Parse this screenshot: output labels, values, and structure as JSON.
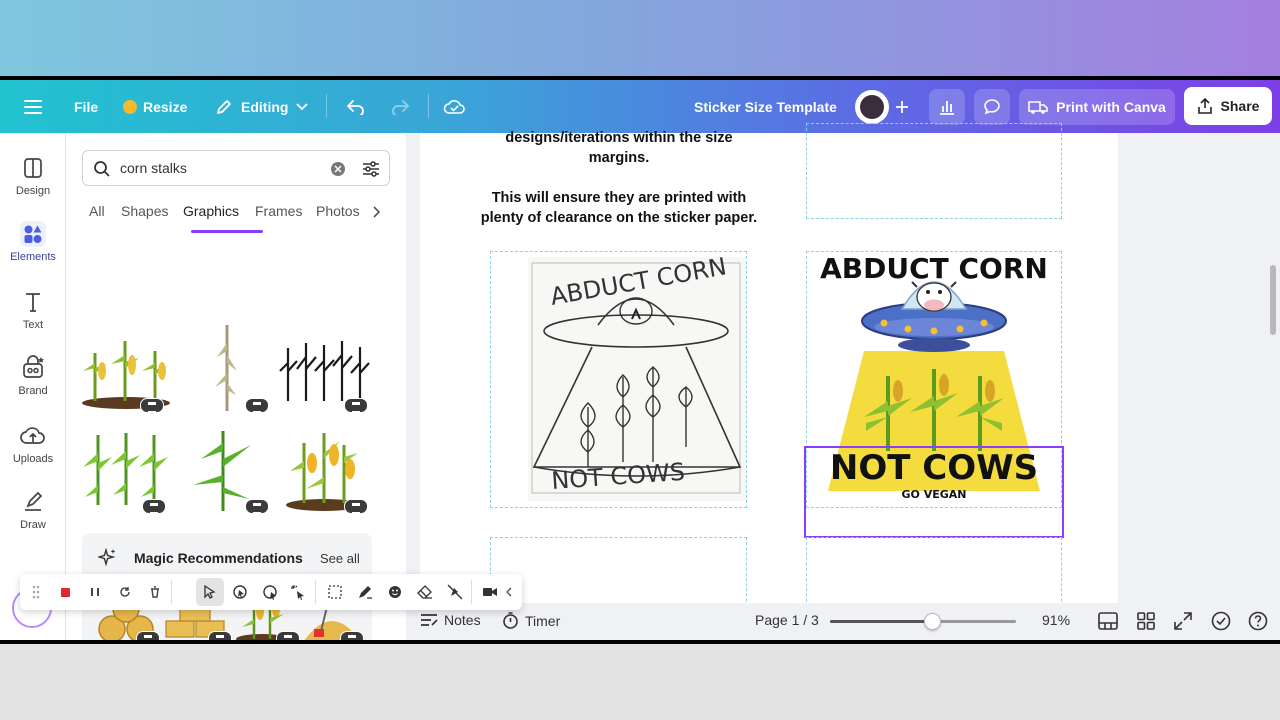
{
  "header": {
    "menu_icon": "hamburger-icon",
    "file_label": "File",
    "resize_label": "Resize",
    "editing_label": "Editing",
    "title": "Sticker Size Template",
    "print_label": "Print with Canva",
    "share_label": "Share",
    "colors": {
      "gradient_start": "#21c2cf",
      "gradient_end": "#7d3fe6",
      "accent": "#8b3dff"
    }
  },
  "rail": {
    "items": [
      {
        "label": "Design",
        "icon": "design-icon"
      },
      {
        "label": "Elements",
        "icon": "elements-icon"
      },
      {
        "label": "Text",
        "icon": "text-icon"
      },
      {
        "label": "Brand",
        "icon": "brand-icon"
      },
      {
        "label": "Uploads",
        "icon": "uploads-icon"
      },
      {
        "label": "Draw",
        "icon": "draw-icon"
      }
    ]
  },
  "panel": {
    "search": {
      "value": "corn stalks"
    },
    "tabs": [
      "All",
      "Shapes",
      "Graphics",
      "Frames",
      "Photos"
    ],
    "active_tab": "Graphics",
    "magic": {
      "title": "Magic Recommendations",
      "see_all": "See all"
    }
  },
  "canvas": {
    "instructions_line1": "designs/iterations within the size",
    "instructions_line2": "margins.",
    "instructions_line3": "This will ensure they are printed with",
    "instructions_line4": "plenty of clearance on the sticker paper.",
    "sketch": {
      "top_text": "ABDUCT CORN",
      "bottom_text": "NOT COWS"
    },
    "sticker": {
      "title": "ABDUCT CORN",
      "subtitle": "NOT COWS",
      "tagline": "GO VEGAN"
    }
  },
  "footer": {
    "notes_label": "Notes",
    "timer_label": "Timer",
    "page_label": "Page 1 / 3",
    "zoom_label": "91%",
    "zoom_fraction": 0.55
  }
}
